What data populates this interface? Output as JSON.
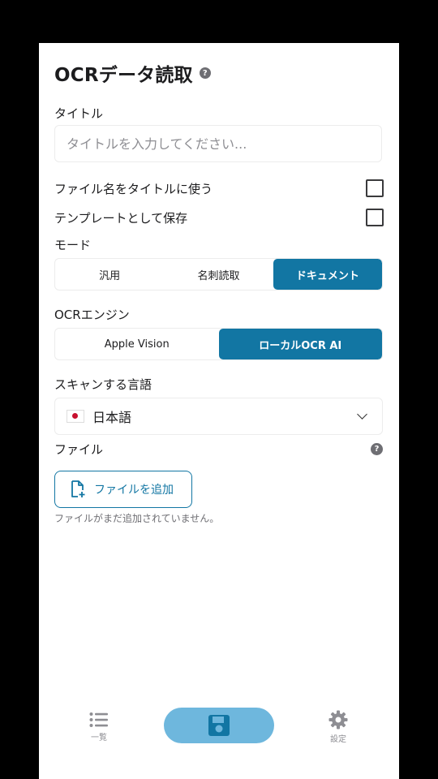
{
  "header": {
    "title": "OCRデータ読取",
    "help_glyph": "?"
  },
  "title_field": {
    "label": "タイトル",
    "placeholder": "タイトルを入力してください..."
  },
  "options": {
    "use_filename": {
      "label": "ファイル名をタイトルに使う",
      "checked": false
    },
    "save_template": {
      "label": "テンプレートとして保存",
      "checked": false
    }
  },
  "mode": {
    "label": "モード",
    "options": [
      "汎用",
      "名刺読取",
      "ドキュメント"
    ],
    "selected": "ドキュメント"
  },
  "engine": {
    "label": "OCRエンジン",
    "options": [
      "Apple Vision",
      "ローカルOCR AI"
    ],
    "selected": "ローカルOCR AI"
  },
  "language": {
    "label": "スキャンする言語",
    "value": "日本語",
    "flag_icon": "japan-flag-icon"
  },
  "files": {
    "label": "ファイル",
    "help_glyph": "?",
    "add_button": "ファイルを追加",
    "empty_hint": "ファイルがまだ追加されていません。"
  },
  "tabbar": {
    "list_label": "一覧",
    "settings_label": "設定",
    "save_icon": "floppy-disk-icon"
  },
  "colors": {
    "accent": "#1276a3",
    "save_button": "#6eb7dd",
    "background": "#000000",
    "card": "#ffffff"
  }
}
